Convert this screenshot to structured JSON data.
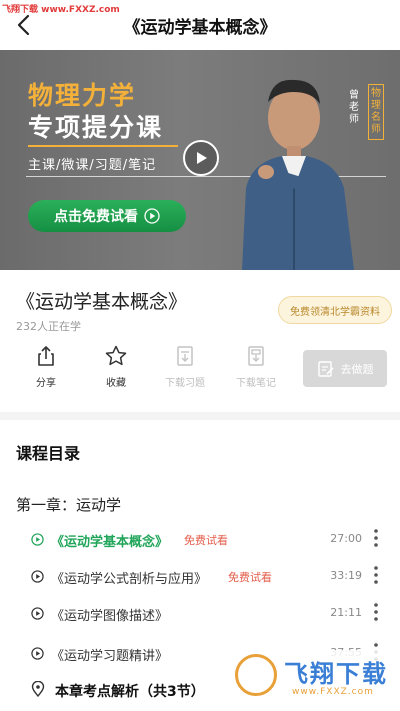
{
  "watermark_top": "飞翔下载 www.FXXZ.com",
  "header": {
    "title": "《运动学基本概念》"
  },
  "banner": {
    "title_line1": "物理力学",
    "title_line2": "专项提分课",
    "tags": "主课/微课/习题/笔记",
    "cta_label": "点击免费试看",
    "teacher_name": "曾老师",
    "teacher_badge": "物理名师",
    "accent_color": "#f3b13a",
    "cta_color": "#1f9e4f"
  },
  "course": {
    "title": "《运动学基本概念》",
    "learners": "232人正在学",
    "promo": "免费领清北学霸资料"
  },
  "actions": {
    "share": "分享",
    "favorite": "收藏",
    "download_exercises": "下载习题",
    "download_notes": "下载笔记",
    "do_exercises": "去做题"
  },
  "catalog": {
    "title": "课程目录",
    "chapter": "第一章：运动学",
    "lessons": [
      {
        "name": "《运动学基本概念》",
        "free": "免费试看",
        "duration": "27:00"
      },
      {
        "name": "《运动学公式剖析与应用》",
        "free": "免费试看",
        "duration": "33:19"
      },
      {
        "name": "《运动学图像描述》",
        "free": "",
        "duration": "21:11"
      },
      {
        "name": "《运动学习题精讲》",
        "free": "",
        "duration": "37:55"
      }
    ],
    "summary": "本章考点解析（共3节）"
  },
  "logo_watermark": {
    "brand": "飞翔下载",
    "url": "www.FXXZ.com"
  },
  "colors": {
    "active": "#21a55a",
    "free_tag": "#e35c4a",
    "disabled": "#bdbdbd"
  }
}
